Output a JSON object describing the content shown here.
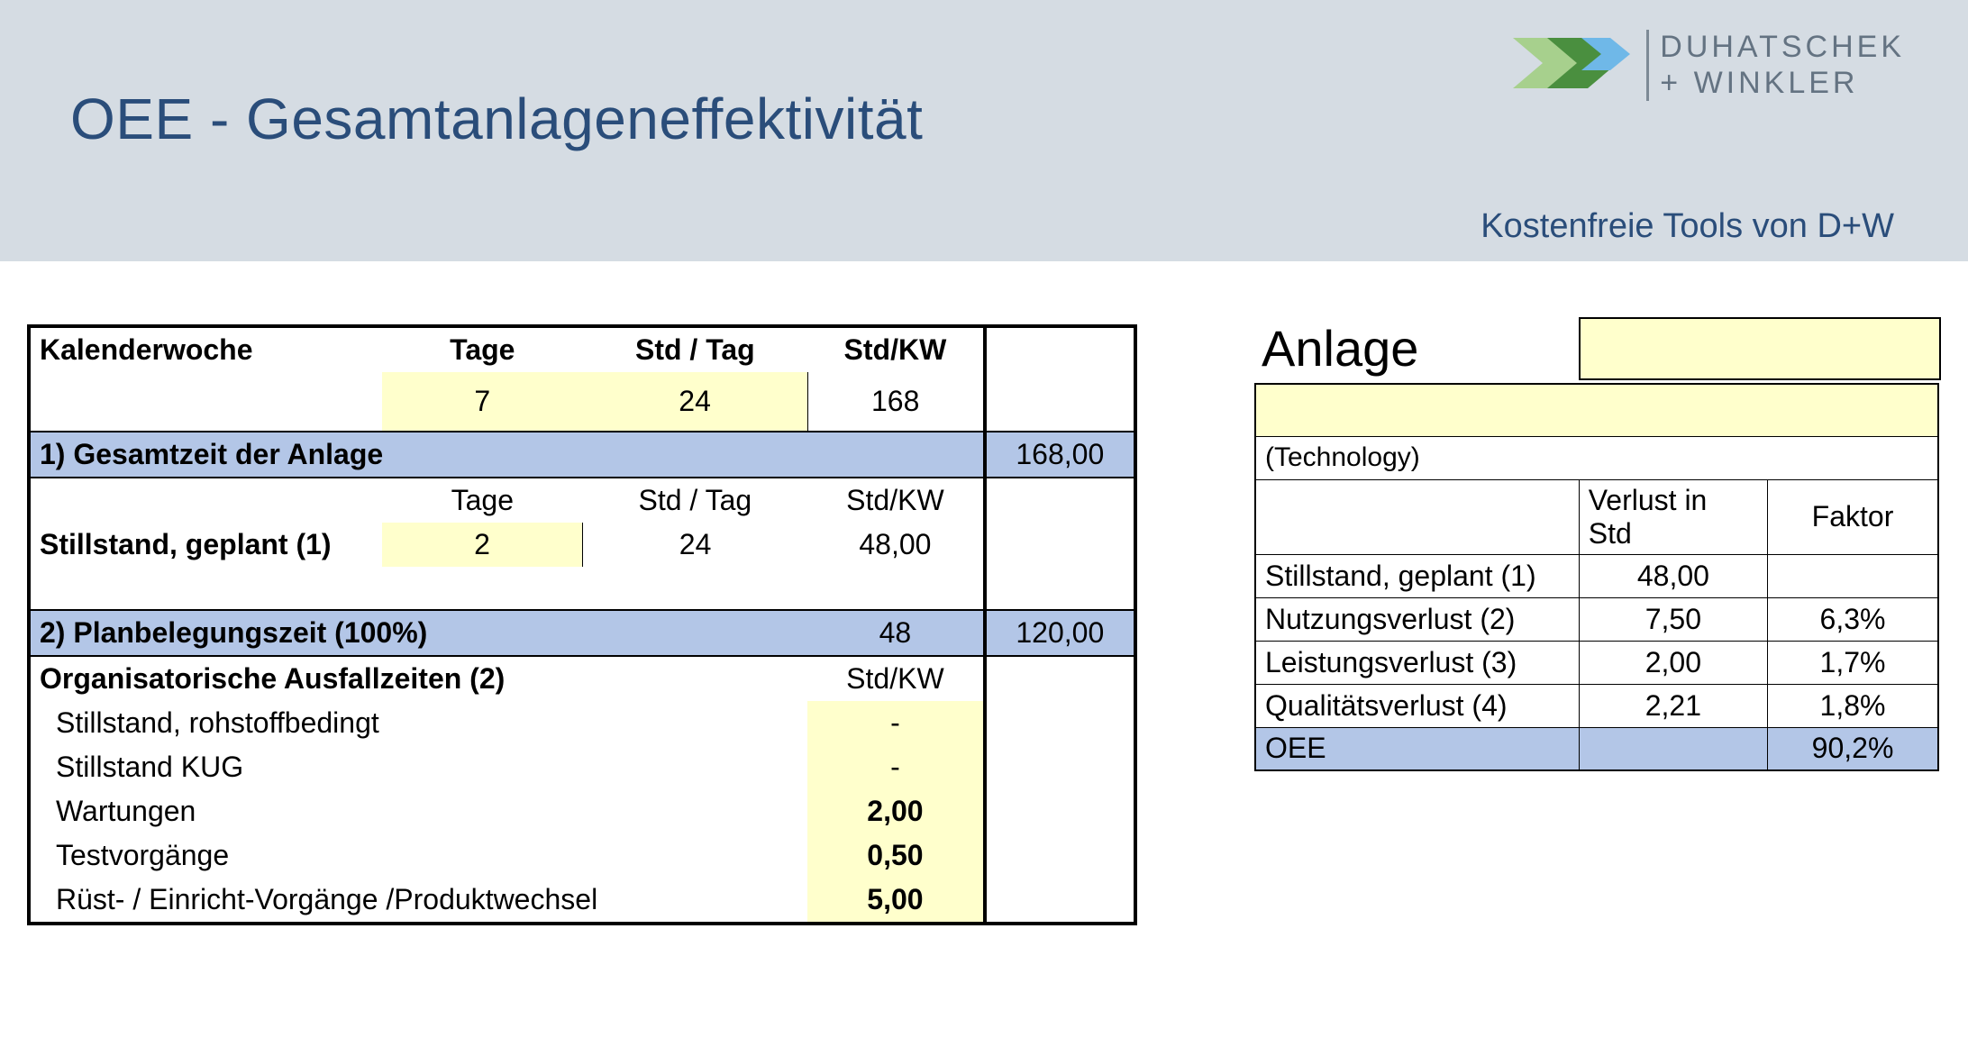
{
  "header": {
    "title": "OEE - Gesamtanlageneffektivität",
    "brand_line1": "DUHATSCHEK",
    "brand_line2": "+ WINKLER",
    "tagline": "Kostenfreie Tools von D+W"
  },
  "left": {
    "kw_label": "Kalenderwoche",
    "col_tage": "Tage",
    "col_stdtag": "Std / Tag",
    "col_stdkw": "Std/KW",
    "tage_val": "7",
    "stdtag_val": "24",
    "stdkw_val": "168",
    "sec1_label": "1) Gesamtzeit der Anlage",
    "sec1_total": "168,00",
    "still_label": "Stillstand, geplant (1)",
    "still_tage": "2",
    "still_stdtag": "24",
    "still_stdkw": "48,00",
    "sec2_label": "2) Planbelegungszeit (100%)",
    "sec2_val": "48",
    "sec2_total": "120,00",
    "org_label": "Organisatorische Ausfallzeiten (2)",
    "org_col": "Std/KW",
    "org_items": [
      {
        "label": "Stillstand, rohstoffbedingt",
        "val": "-"
      },
      {
        "label": "Stillstand KUG",
        "val": "-"
      },
      {
        "label": "Wartungen",
        "val": "2,00"
      },
      {
        "label": "Testvorgänge",
        "val": "0,50"
      },
      {
        "label": "Rüst- / Einricht-Vorgänge /Produktwechsel",
        "val": "5,00"
      }
    ]
  },
  "right": {
    "anlage_label": "Anlage",
    "tech_label": "(Technology)",
    "col_loss": "Verlust in Std",
    "col_factor": "Faktor",
    "rows": [
      {
        "label": "Stillstand, geplant (1)",
        "loss": "48,00",
        "factor": ""
      },
      {
        "label": "Nutzungsverlust (2)",
        "loss": "7,50",
        "factor": "6,3%"
      },
      {
        "label": "Leistungsverlust (3)",
        "loss": "2,00",
        "factor": "1,7%"
      },
      {
        "label": "Qualitätsverlust (4)",
        "loss": "2,21",
        "factor": "1,8%"
      }
    ],
    "oee_label": "OEE",
    "oee_value": "90,2%"
  }
}
